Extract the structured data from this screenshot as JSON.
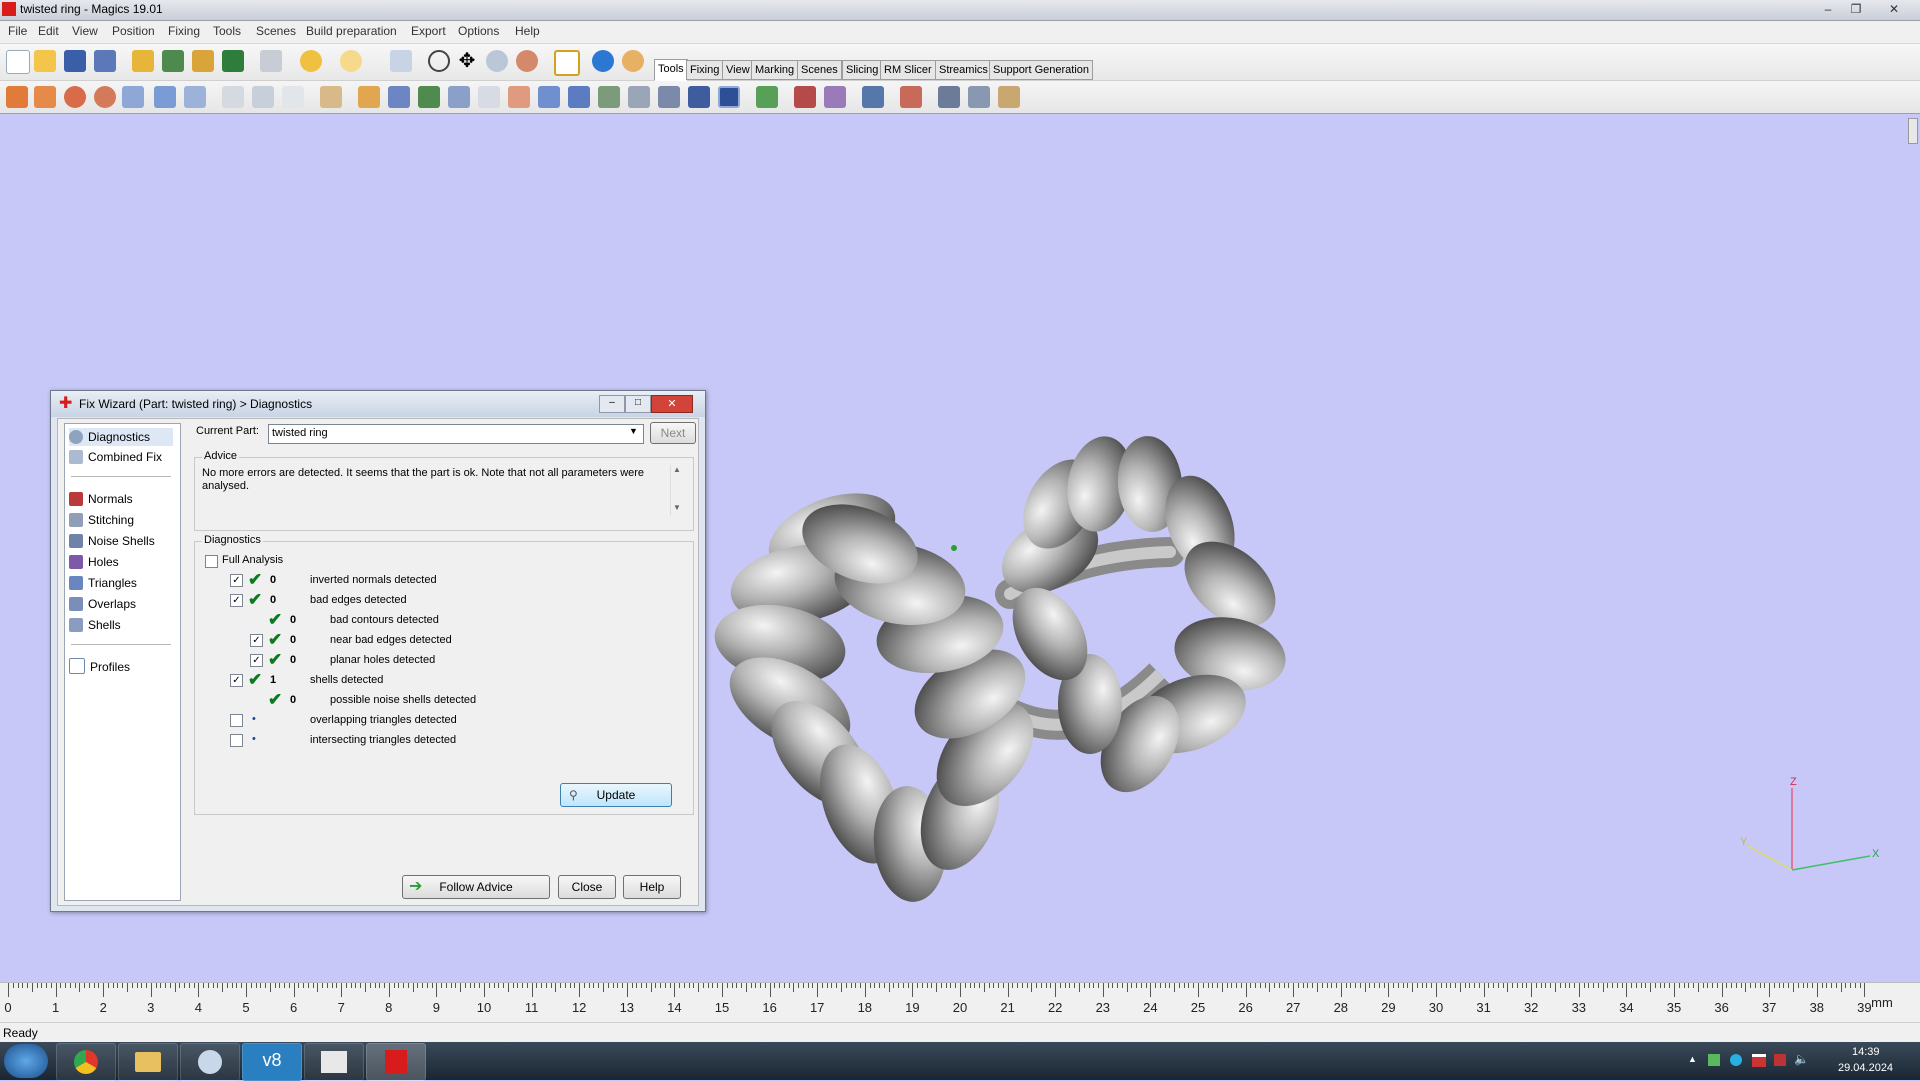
{
  "window": {
    "title": "twisted ring - Magics 19.01"
  },
  "menu": [
    "File",
    "Edit",
    "View",
    "Position",
    "Fixing",
    "Tools",
    "Scenes",
    "Build preparation",
    "Export",
    "Options",
    "Help"
  ],
  "tabs": [
    "Tools",
    "Fixing",
    "View",
    "Marking",
    "Scenes",
    "Slicing",
    "RM Slicer",
    "Streamics",
    "Support Generation"
  ],
  "dialog": {
    "title": "Fix Wizard (Part: twisted ring) > Diagnostics",
    "nav_top": [
      "Diagnostics",
      "Combined Fix"
    ],
    "nav_tools": [
      "Normals",
      "Stitching",
      "Noise Shells",
      "Holes",
      "Triangles",
      "Overlaps",
      "Shells"
    ],
    "nav_bottom": [
      "Profiles"
    ],
    "current_part_label": "Current Part:",
    "current_part_value": "twisted ring",
    "next_label": "Next",
    "advice_label": "Advice",
    "advice_text": "No more errors are detected. It seems that the part is ok. Note that not all parameters were analysed.",
    "diagnostics_label": "Diagnostics",
    "full_analysis_label": "Full Analysis",
    "rows": [
      {
        "count": "0",
        "label": "inverted normals detected",
        "indent": 0,
        "checked": true,
        "ok": true
      },
      {
        "count": "0",
        "label": "bad edges detected",
        "indent": 0,
        "checked": true,
        "ok": true
      },
      {
        "count": "0",
        "label": "bad contours detected",
        "indent": 1,
        "checked": false,
        "ok": true
      },
      {
        "count": "0",
        "label": "near bad edges detected",
        "indent": 1,
        "checked": true,
        "ok": true
      },
      {
        "count": "0",
        "label": "planar holes detected",
        "indent": 1,
        "checked": true,
        "ok": true
      },
      {
        "count": "1",
        "label": "shells detected",
        "indent": 0,
        "checked": true,
        "ok": true
      },
      {
        "count": "0",
        "label": "possible noise shells detected",
        "indent": 1,
        "checked": false,
        "ok": true
      },
      {
        "count": "",
        "label": "overlapping triangles detected",
        "indent": 0,
        "checked": false,
        "ok": false
      },
      {
        "count": "",
        "label": "intersecting triangles detected",
        "indent": 0,
        "checked": false,
        "ok": false
      }
    ],
    "update_label": "Update",
    "follow_advice_label": "Follow Advice",
    "close_label": "Close",
    "help_label": "Help"
  },
  "axes": {
    "z": "Z",
    "y": "Y",
    "x": "X"
  },
  "ruler": {
    "ticks": [
      "0",
      "1",
      "2",
      "3",
      "4",
      "5",
      "6",
      "7",
      "8",
      "9",
      "10",
      "11",
      "12",
      "13",
      "14",
      "15",
      "16",
      "17",
      "18",
      "19",
      "20",
      "21",
      "22",
      "23",
      "24",
      "25",
      "26",
      "27",
      "28",
      "29",
      "30",
      "31",
      "32",
      "33",
      "34",
      "35",
      "36",
      "37",
      "38",
      "39"
    ],
    "unit": "mm"
  },
  "status": "Ready",
  "clock": {
    "time": "14:39",
    "date": "29.04.2024"
  },
  "colors": {
    "viewport": "#c8c8f8",
    "ok_check": "#0c7a1e",
    "accent": "#d81b1b"
  }
}
